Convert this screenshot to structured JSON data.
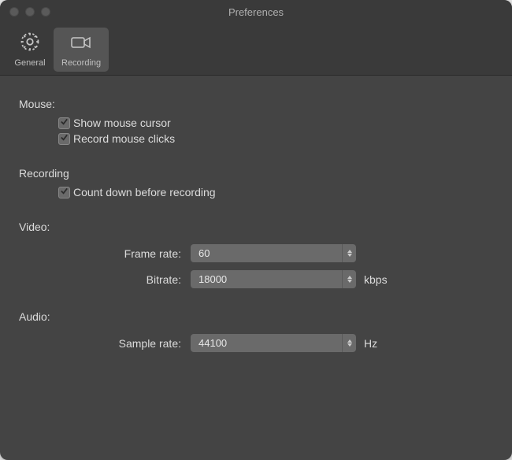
{
  "window": {
    "title": "Preferences"
  },
  "toolbar": {
    "general": "General",
    "recording": "Recording"
  },
  "sections": {
    "mouse": {
      "title": "Mouse:",
      "show_cursor_label": "Show mouse cursor",
      "record_clicks_label": "Record mouse clicks"
    },
    "recording": {
      "title": "Recording",
      "countdown_label": "Count down before recording"
    },
    "video": {
      "title": "Video:",
      "frame_rate_label": "Frame rate:",
      "frame_rate_value": "60",
      "bitrate_label": "Bitrate:",
      "bitrate_value": "18000",
      "bitrate_unit": "kbps"
    },
    "audio": {
      "title": "Audio:",
      "sample_rate_label": "Sample rate:",
      "sample_rate_value": "44100",
      "sample_rate_unit": "Hz"
    }
  }
}
